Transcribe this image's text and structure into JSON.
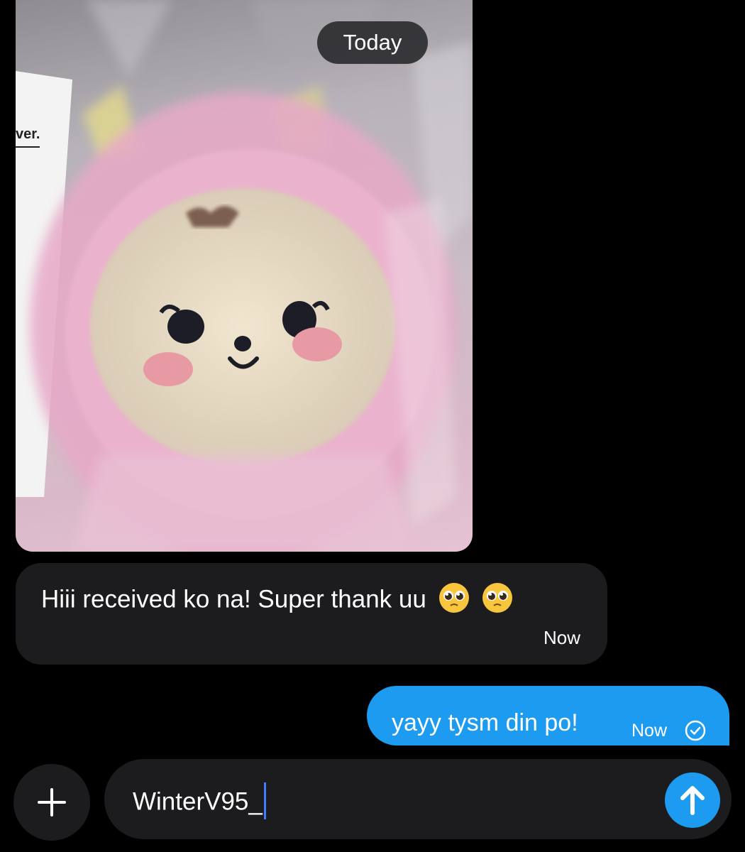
{
  "conversation": {
    "date_divider": "Today",
    "photo": {
      "label_fragment": "ver.",
      "icon": "image-attachment"
    },
    "incoming": {
      "text": "Hiii received ko na! Super thank uu",
      "emoji": [
        "pleading-face-emoji",
        "pleading-face-emoji"
      ],
      "time": "Now"
    },
    "outgoing": {
      "text": "yayy tysm din po!",
      "time": "Now",
      "status_icon": "read-check-icon"
    }
  },
  "composer": {
    "value": "WinterV95_",
    "add_icon": "plus-icon",
    "send_icon": "arrow-up-icon"
  },
  "colors": {
    "background": "#000000",
    "bubble_in": "#1c1c1f",
    "bubble_out": "#1d9bf0",
    "send_button": "#1d9bf0",
    "caret": "#3f7cff"
  }
}
